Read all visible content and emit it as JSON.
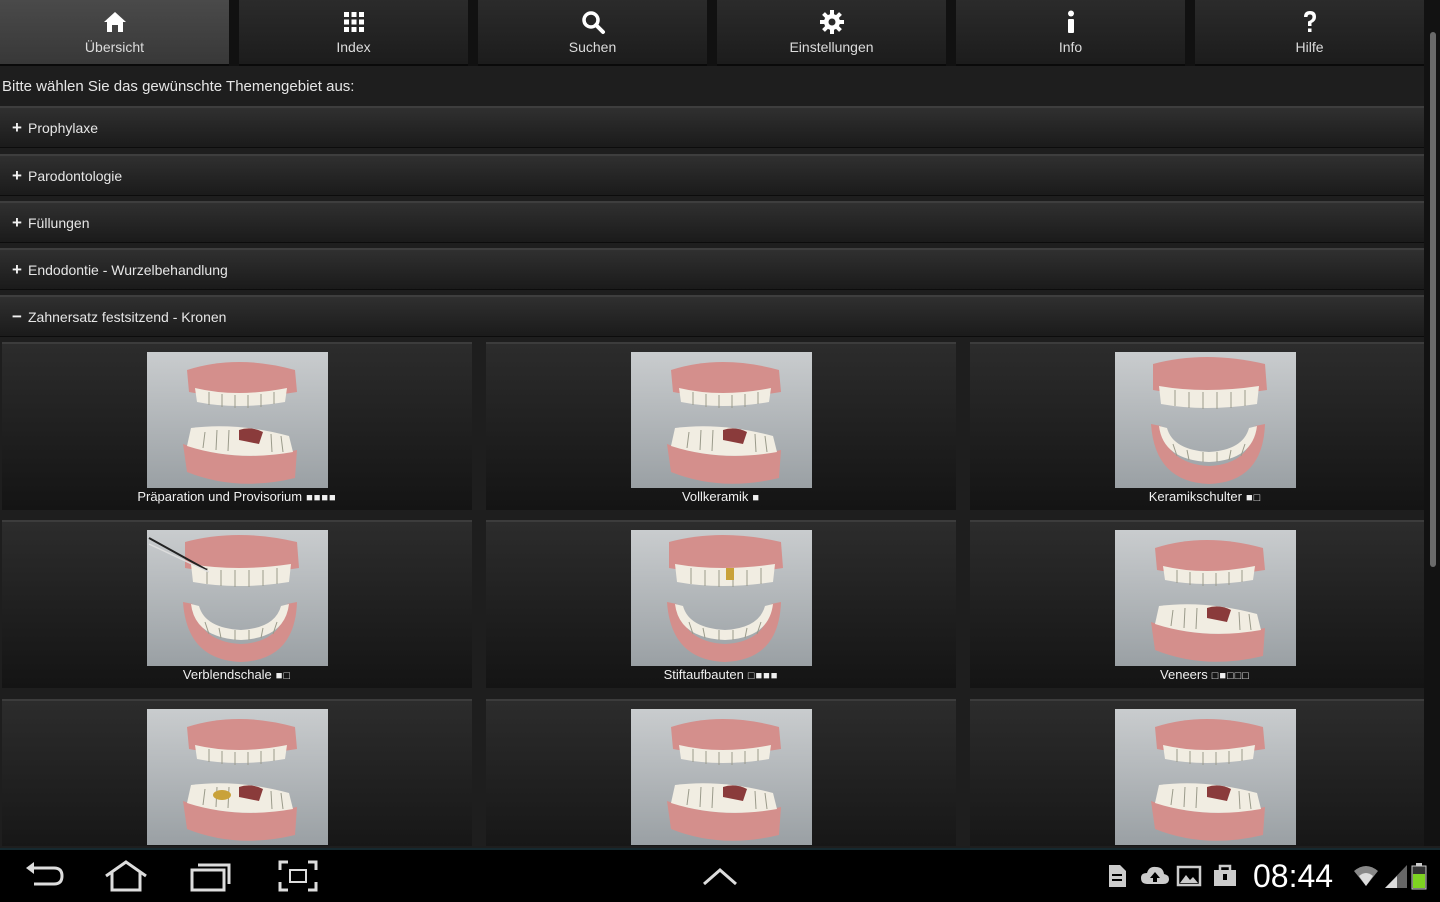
{
  "tabs": [
    {
      "label": "Übersicht",
      "icon": "home-icon",
      "active": true
    },
    {
      "label": "Index",
      "icon": "grid-icon",
      "active": false
    },
    {
      "label": "Suchen",
      "icon": "search-icon",
      "active": false
    },
    {
      "label": "Einstellungen",
      "icon": "gear-icon",
      "active": false
    },
    {
      "label": "Info",
      "icon": "info-icon",
      "active": false
    },
    {
      "label": "Hilfe",
      "icon": "help-icon",
      "active": false
    }
  ],
  "prompt": "Bitte wählen Sie das gewünschte Themengebiet aus:",
  "sections": [
    {
      "label": "Prophylaxe",
      "sign": "+"
    },
    {
      "label": "Parodontologie",
      "sign": "+"
    },
    {
      "label": "Füllungen",
      "sign": "+"
    },
    {
      "label": "Endodontie - Wurzelbehandlung",
      "sign": "+"
    },
    {
      "label": "Zahnersatz festsitzend - Kronen",
      "sign": "−"
    }
  ],
  "items": [
    {
      "label": "Präparation und Provisorium",
      "dots": "■■■■"
    },
    {
      "label": "Vollkeramik",
      "dots": "■"
    },
    {
      "label": "Keramikschulter",
      "dots": "■□"
    },
    {
      "label": "Verblendschale",
      "dots": "■□"
    },
    {
      "label": "Stiftaufbauten",
      "dots": "□■■■"
    },
    {
      "label": "Veneers",
      "dots": "□■□□□"
    },
    {
      "label": "",
      "dots": ""
    },
    {
      "label": "",
      "dots": ""
    },
    {
      "label": "",
      "dots": ""
    }
  ],
  "status": {
    "time": "08:44"
  },
  "colors": {
    "background": "#1e1e1e",
    "tab_active": "#404040",
    "thumb_bg": "#b5b9bc",
    "gum": "#d48f8c"
  }
}
